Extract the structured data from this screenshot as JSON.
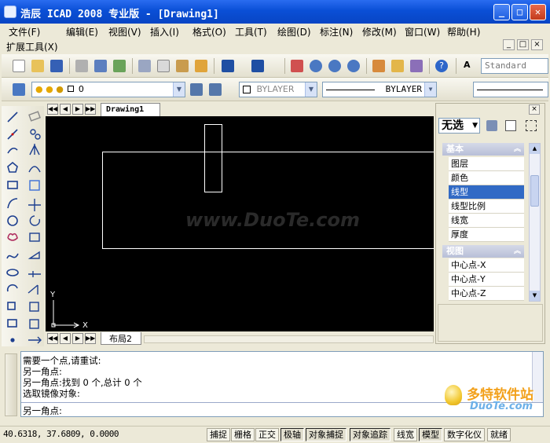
{
  "window": {
    "title": "浩辰 ICAD 2008 专业版 - [Drawing1]",
    "min": "_",
    "max": "□",
    "close": "✕"
  },
  "menu": {
    "items": [
      "文件(F)",
      "编辑(E)",
      "视图(V)",
      "插入(I)",
      "格式(O)",
      "工具(T)",
      "绘图(D)",
      "标注(N)",
      "修改(M)",
      "窗口(W)",
      "帮助(H)"
    ],
    "ext": "扩展工具(X)",
    "mdi": [
      "_",
      "□",
      "×"
    ]
  },
  "toolbar": {
    "textstyle": "Standard",
    "layer": "0",
    "color": "BYLAYER",
    "linetype": "BYLAYER"
  },
  "tabs": {
    "document": "Drawing1",
    "layout": "布局2",
    "nav": [
      "◀◀",
      "◀",
      "▶",
      "▶▶"
    ]
  },
  "axes": {
    "y": "Y",
    "x": "X"
  },
  "watermark": "www.DuoTe.com",
  "properties": {
    "selection": "无选",
    "groups": [
      {
        "title": "基本",
        "rows": [
          "图层",
          "颜色",
          "线型",
          "线型比例",
          "线宽",
          "厚度"
        ],
        "selected": "线型"
      },
      {
        "title": "视图",
        "rows": [
          "中心点-X",
          "中心点-Y",
          "中心点-Z"
        ]
      }
    ]
  },
  "command": {
    "lines": [
      "需要一个点,请重试:",
      "另一角点:",
      "另一角点:找到 0 个,总计 0 个",
      "选取镜像对象:"
    ],
    "prompt": "另一角点:"
  },
  "status": {
    "coords": "40.6318, 37.6809, 0.0000",
    "buttons": [
      {
        "label": "捕捉",
        "on": false
      },
      {
        "label": "栅格",
        "on": false
      },
      {
        "label": "正交",
        "on": false
      },
      {
        "label": "极轴",
        "on": true
      },
      {
        "label": "对象捕捉",
        "on": true
      },
      {
        "label": "对象追踪",
        "on": true
      },
      {
        "label": "线宽",
        "on": false
      },
      {
        "label": "模型",
        "on": true
      },
      {
        "label": "数字化仪",
        "on": false
      },
      {
        "label": "就绪",
        "on": false
      }
    ]
  },
  "brand": {
    "name": "多特软件站",
    "url": "DuoTe.com"
  },
  "colors": {
    "titlebar": "#0a4fd6",
    "canvas": "#000000",
    "selection": "#316ac5",
    "shape_stroke": "#ffffff"
  }
}
